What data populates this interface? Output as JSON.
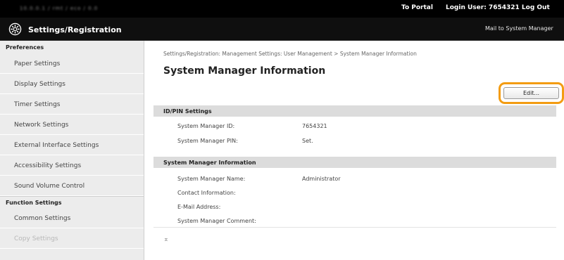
{
  "topbar": {
    "url": "10.0.0.1 / rmt / eco / 0.0",
    "portal_label": "To Portal",
    "login_label": "Login User:  7654321  Log Out"
  },
  "appbar": {
    "title": "Settings/Registration",
    "icon": "settings-gear-icon",
    "mail_link": "Mail to System Manager"
  },
  "sidebar": {
    "preferences_heading": "Preferences",
    "preferences_items": [
      {
        "label": "Paper Settings"
      },
      {
        "label": "Display Settings"
      },
      {
        "label": "Timer Settings"
      },
      {
        "label": "Network Settings"
      },
      {
        "label": "External Interface Settings"
      },
      {
        "label": "Accessibility Settings"
      },
      {
        "label": "Sound Volume Control"
      }
    ],
    "function_heading": "Function Settings",
    "function_items": [
      {
        "label": "Common Settings"
      },
      {
        "label": "Copy Settings"
      }
    ]
  },
  "main": {
    "breadcrumb": "Settings/Registration: Management Settings: User Management > System Manager Information",
    "title": "System Manager Information",
    "edit_button": "Edit...",
    "sections": [
      {
        "heading": "ID/PIN Settings",
        "rows": [
          {
            "label": "System Manager ID:",
            "value": "7654321"
          },
          {
            "label": "System Manager PIN:",
            "value": "Set."
          }
        ]
      },
      {
        "heading": "System Manager Information",
        "rows": [
          {
            "label": "System Manager Name:",
            "value": "Administrator"
          },
          {
            "label": "Contact Information:",
            "value": ""
          },
          {
            "label": "E-Mail Address:",
            "value": ""
          },
          {
            "label": "System Manager Comment:",
            "value": ""
          }
        ]
      }
    ],
    "top_link": "⌅"
  },
  "colors": {
    "topbar_bg": "#000000",
    "appbar_bg": "#0f0f0f",
    "sidebar_bg": "#ececec",
    "section_head_bg": "#dcdcdc",
    "highlight": "#f39c12"
  }
}
